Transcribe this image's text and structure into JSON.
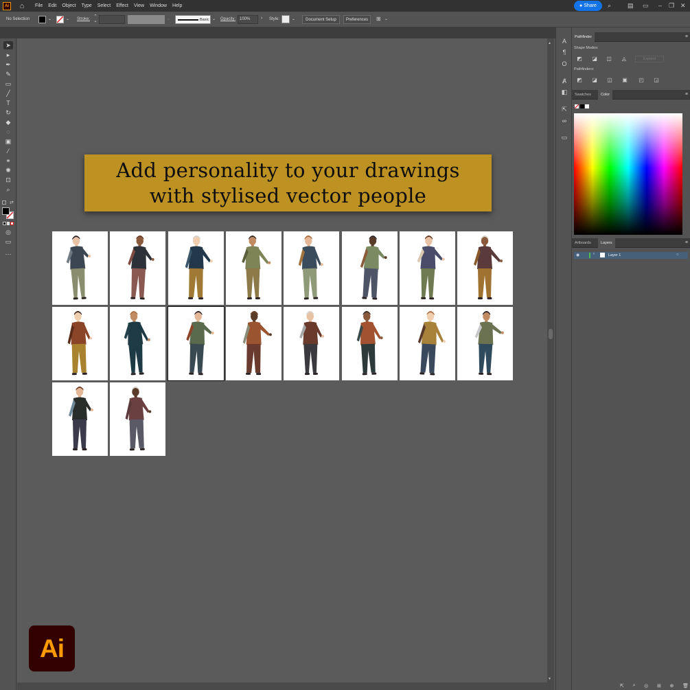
{
  "app": {
    "logo_text": "Ai"
  },
  "menubar": {
    "items": [
      "File",
      "Edit",
      "Object",
      "Type",
      "Select",
      "Effect",
      "View",
      "Window",
      "Help"
    ],
    "share_label": "Share"
  },
  "controlbar": {
    "selection_label": "No Selection",
    "stroke_label": "Stroke:",
    "brush_label": "Basic",
    "opacity_label": "Opacity:",
    "opacity_value": "100%",
    "style_label": "Style:",
    "document_setup_label": "Document Setup",
    "preferences_label": "Preferences"
  },
  "panels": {
    "pathfinder": {
      "tab_label": "Pathfinder",
      "shape_modes_label": "Shape Modes:",
      "expand_label": "Expand",
      "pathfinders_label": "Pathfinders:"
    },
    "color": {
      "tabs": [
        "Swatches",
        "Color"
      ],
      "active_tab": "Color"
    },
    "layers": {
      "tabs": [
        "Artboards",
        "Layers"
      ],
      "active_tab": "Layers",
      "layer_name": "Layer 1",
      "layer_color": "#4fbf4f"
    }
  },
  "banner": {
    "line1": "Add personality to your drawings",
    "line2": "with stylised vector people",
    "background": "#be9222"
  },
  "gallery": {
    "figures": [
      {
        "name": "figure-crouching-reach",
        "top": "#3c4652",
        "bottom": "#8a8e6e",
        "accent": "#6f7a82"
      },
      {
        "name": "figure-hijab-patterned-pants",
        "top": "#2d3238",
        "bottom": "#8a5a52",
        "accent": "#7f4b42"
      },
      {
        "name": "figure-walking-coat",
        "top": "#22384a",
        "bottom": "#a07a34",
        "accent": "#3a5568"
      },
      {
        "name": "figure-hood-gesturing",
        "top": "#7e8456",
        "bottom": "#8c7a48",
        "accent": "#5b5f3c"
      },
      {
        "name": "figure-sitting-cross-legged",
        "top": "#3b4c5c",
        "bottom": "#8e9a78",
        "accent": "#a3733b"
      },
      {
        "name": "figure-elder-cane",
        "top": "#7a8a62",
        "bottom": "#4e5566",
        "accent": "#8a5a3a"
      },
      {
        "name": "figure-sitting-elder",
        "top": "#4a4c6a",
        "bottom": "#6f7a52",
        "accent": "#d8c8b0"
      },
      {
        "name": "figure-woman-handbag",
        "top": "#5a3a3a",
        "bottom": "#a07232",
        "accent": "#8a5a2a"
      },
      {
        "name": "figure-hat-mustard",
        "top": "#8a4428",
        "bottom": "#a8822e",
        "accent": "#5a2c1a"
      },
      {
        "name": "figure-long-dress",
        "top": "#1e3a44",
        "bottom": "#1e3a44",
        "accent": "#233f4a"
      },
      {
        "name": "figure-striped-back",
        "top": "#5a6a4c",
        "bottom": "#3a4a52",
        "accent": "#8a4428"
      },
      {
        "name": "figure-backpacker",
        "top": "#9a5530",
        "bottom": "#6a3a2e",
        "accent": "#8a8e78"
      },
      {
        "name": "figure-apron-dress",
        "top": "#6a3a2c",
        "bottom": "#3a3a3e",
        "accent": "#a7a7a7"
      },
      {
        "name": "figure-sweater-skirt",
        "top": "#a25230",
        "bottom": "#2e3a3a",
        "accent": "#3a4a4a"
      },
      {
        "name": "figure-mother-child",
        "top": "#a8823a",
        "bottom": "#3a4a5c",
        "accent": "#5a3a2a"
      },
      {
        "name": "figure-waving-backpack",
        "top": "#6a7252",
        "bottom": "#2e4a5c",
        "accent": "#c8c8c8"
      },
      {
        "name": "figure-quilted-vest",
        "top": "#2a2e2a",
        "bottom": "#3a3a4a",
        "accent": "#6e8a9a"
      },
      {
        "name": "figure-raised-arm",
        "top": "#6a4040",
        "bottom": "#5a5a66",
        "accent": "#5a3a3a"
      }
    ],
    "selected_index": 10
  }
}
